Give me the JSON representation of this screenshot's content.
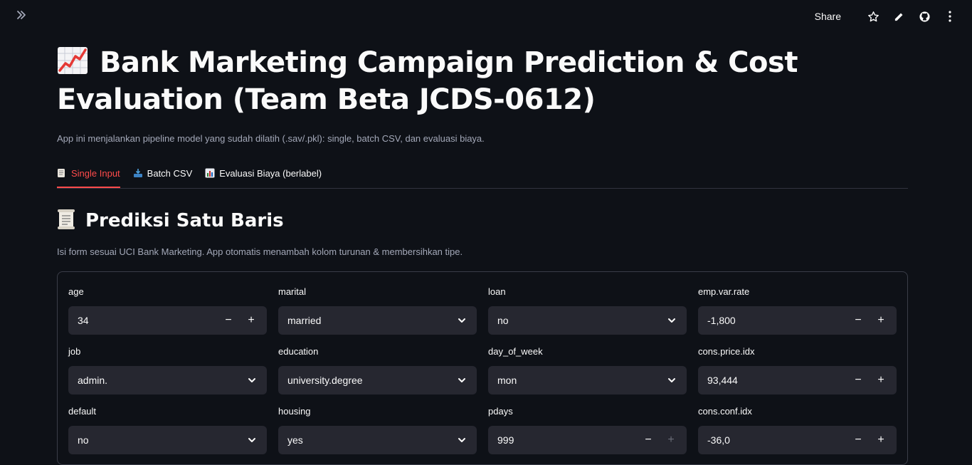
{
  "toolbar": {
    "share_label": "Share"
  },
  "header": {
    "title": "Bank Marketing Campaign Prediction & Cost Evaluation (Team Beta JCDS-0612)",
    "subtitle": "App ini menjalankan pipeline model yang sudah dilatih (.sav/.pkl): single, batch CSV, dan evaluasi biaya."
  },
  "tabs": [
    {
      "label": "Single Input",
      "icon": "scroll-icon",
      "active": true
    },
    {
      "label": "Batch CSV",
      "icon": "inbox-tray-icon",
      "active": false
    },
    {
      "label": "Evaluasi Biaya (berlabel)",
      "icon": "bar-chart-icon",
      "active": false
    }
  ],
  "section": {
    "title": "Prediksi Satu Baris",
    "caption": "Isi form sesuai UCI Bank Marketing. App otomatis menambah kolom turunan & membersihkan tipe."
  },
  "form": {
    "age": {
      "label": "age",
      "value": "34"
    },
    "marital": {
      "label": "marital",
      "value": "married"
    },
    "loan": {
      "label": "loan",
      "value": "no"
    },
    "emp_var_rate": {
      "label": "emp.var.rate",
      "value": "-1,800"
    },
    "job": {
      "label": "job",
      "value": "admin."
    },
    "education": {
      "label": "education",
      "value": "university.degree"
    },
    "day_of_week": {
      "label": "day_of_week",
      "value": "mon"
    },
    "cons_price_idx": {
      "label": "cons.price.idx",
      "value": "93,444"
    },
    "default": {
      "label": "default",
      "value": "no"
    },
    "housing": {
      "label": "housing",
      "value": "yes"
    },
    "pdays": {
      "label": "pdays",
      "value": "999"
    },
    "cons_conf_idx": {
      "label": "cons.conf.idx",
      "value": "-36,0"
    }
  },
  "stepper": {
    "minus": "−",
    "plus": "+"
  },
  "colors": {
    "background": "#0e1117",
    "accent": "#ff4b4b",
    "input_bg": "#262730",
    "muted_text": "#a3a8b8"
  }
}
